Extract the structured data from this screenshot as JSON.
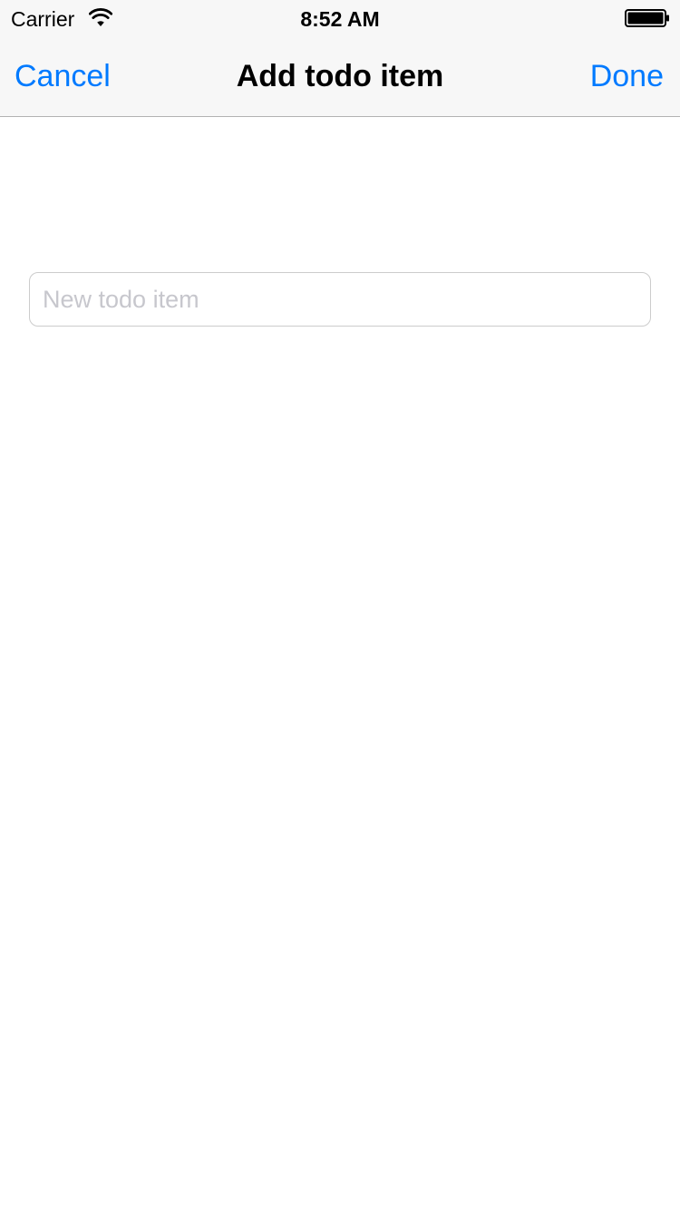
{
  "status_bar": {
    "carrier": "Carrier",
    "time": "8:52 AM",
    "wifi_icon": "wifi-icon",
    "battery_icon": "battery-icon"
  },
  "nav_bar": {
    "cancel_label": "Cancel",
    "title": "Add todo item",
    "done_label": "Done"
  },
  "form": {
    "todo_value": "",
    "todo_placeholder": "New todo item"
  },
  "colors": {
    "accent": "#007aff",
    "nav_background": "#f7f7f7",
    "placeholder": "#c7c7cd",
    "field_border": "#cccccc"
  }
}
